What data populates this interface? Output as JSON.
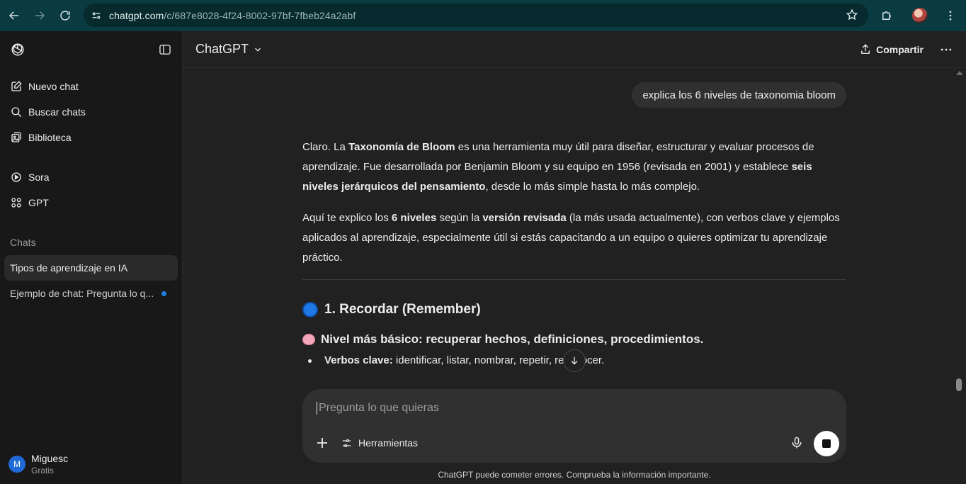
{
  "browser": {
    "url_domain": "chatgpt.com",
    "url_path": "/c/687e8028-4f24-8002-97bf-7fbeb24a2abf"
  },
  "sidebar": {
    "items": [
      {
        "label": "Nuevo chat",
        "icon": "edit-icon"
      },
      {
        "label": "Buscar chats",
        "icon": "search-icon"
      },
      {
        "label": "Biblioteca",
        "icon": "library-icon"
      },
      {
        "label": "Sora",
        "icon": "sora-icon"
      },
      {
        "label": "GPT",
        "icon": "grid-icon"
      }
    ],
    "section_label": "Chats",
    "chats": [
      {
        "title": "Tipos de aprendizaje en IA"
      },
      {
        "title": "Ejemplo de chat: Pregunta lo q..."
      }
    ],
    "user": {
      "initial": "M",
      "name": "Miguesc",
      "plan": "Gratis"
    }
  },
  "header": {
    "title": "ChatGPT",
    "share_label": "Compartir"
  },
  "conversation": {
    "user_message": "explica los 6 niveles de taxonomia bloom",
    "p1": [
      "Claro. La ",
      "Taxonomía de Bloom",
      " es una herramienta muy útil para diseñar, estructurar y evaluar procesos de aprendizaje. Fue desarrollada por Benjamin Bloom y su equipo en 1956 (revisada en 2001) y establece ",
      "seis niveles jerárquicos del pensamiento",
      ", desde lo más simple hasta lo más complejo."
    ],
    "p2": [
      "Aquí te explico los ",
      "6 niveles",
      " según la ",
      "versión revisada",
      " (la más usada actualmente), con verbos clave y ejemplos aplicados al aprendizaje, especialmente útil si estás capacitando a un equipo o quieres optimizar tu aprendizaje práctico."
    ],
    "level1_heading": "1. Recordar (Remember)",
    "level1_sub": "Nivel más básico: recuperar hechos, definiciones, procedimientos.",
    "bullet1_label": "Verbos clave:",
    "bullet1_text": " identificar, listar, nombrar, repetir, reconocer."
  },
  "composer": {
    "placeholder": "Pregunta lo que quieras",
    "tools_label": "Herramientas"
  },
  "footer_note": "ChatGPT puede cometer errores. Comprueba la información importante."
}
